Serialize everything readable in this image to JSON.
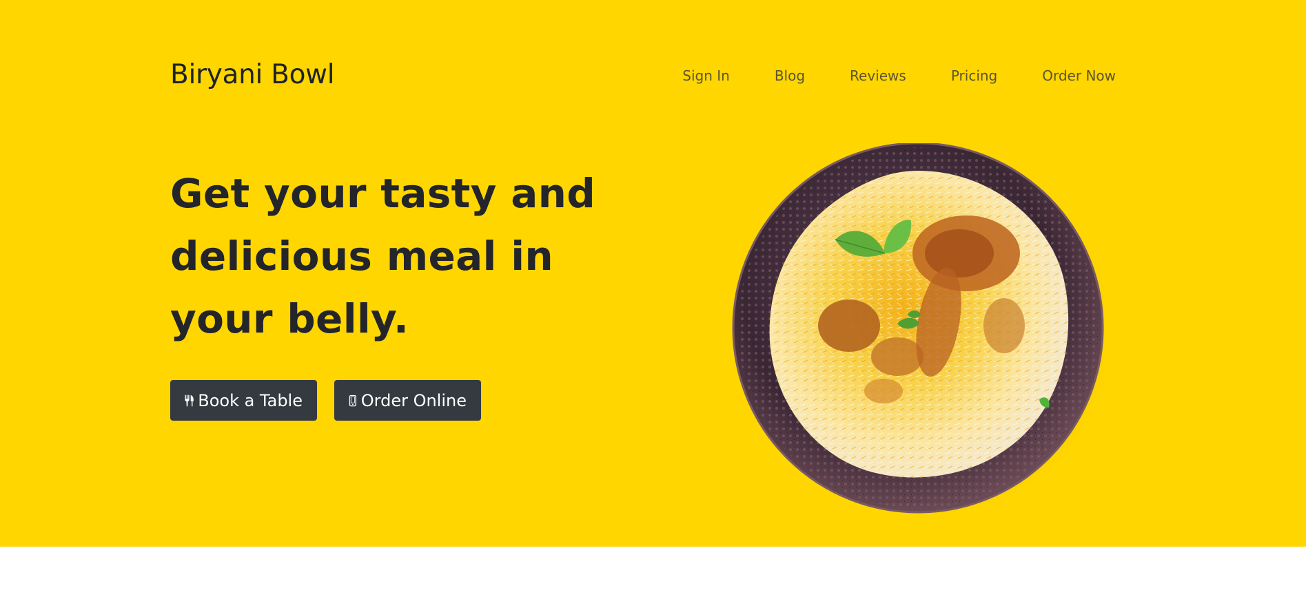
{
  "brand": {
    "name": "Biryani Bowl"
  },
  "nav": {
    "items": [
      {
        "label": "Sign In"
      },
      {
        "label": "Blog"
      },
      {
        "label": "Reviews"
      },
      {
        "label": "Pricing"
      },
      {
        "label": "Order Now"
      }
    ]
  },
  "hero": {
    "headline_lines": [
      "Get your tasty and",
      "delicious meal in",
      "your belly."
    ],
    "buttons": {
      "book_label": "Book a Table",
      "book_icon": "cutlery-icon",
      "order_label": "Order Online",
      "order_icon": "mobile-phone-icon"
    },
    "image": {
      "subject": "biryani-plate-image"
    }
  },
  "colors": {
    "hero_background": "#FFD600",
    "button_background": "#343a40",
    "headline_text": "#23252b",
    "nav_text": "#5c5432"
  }
}
